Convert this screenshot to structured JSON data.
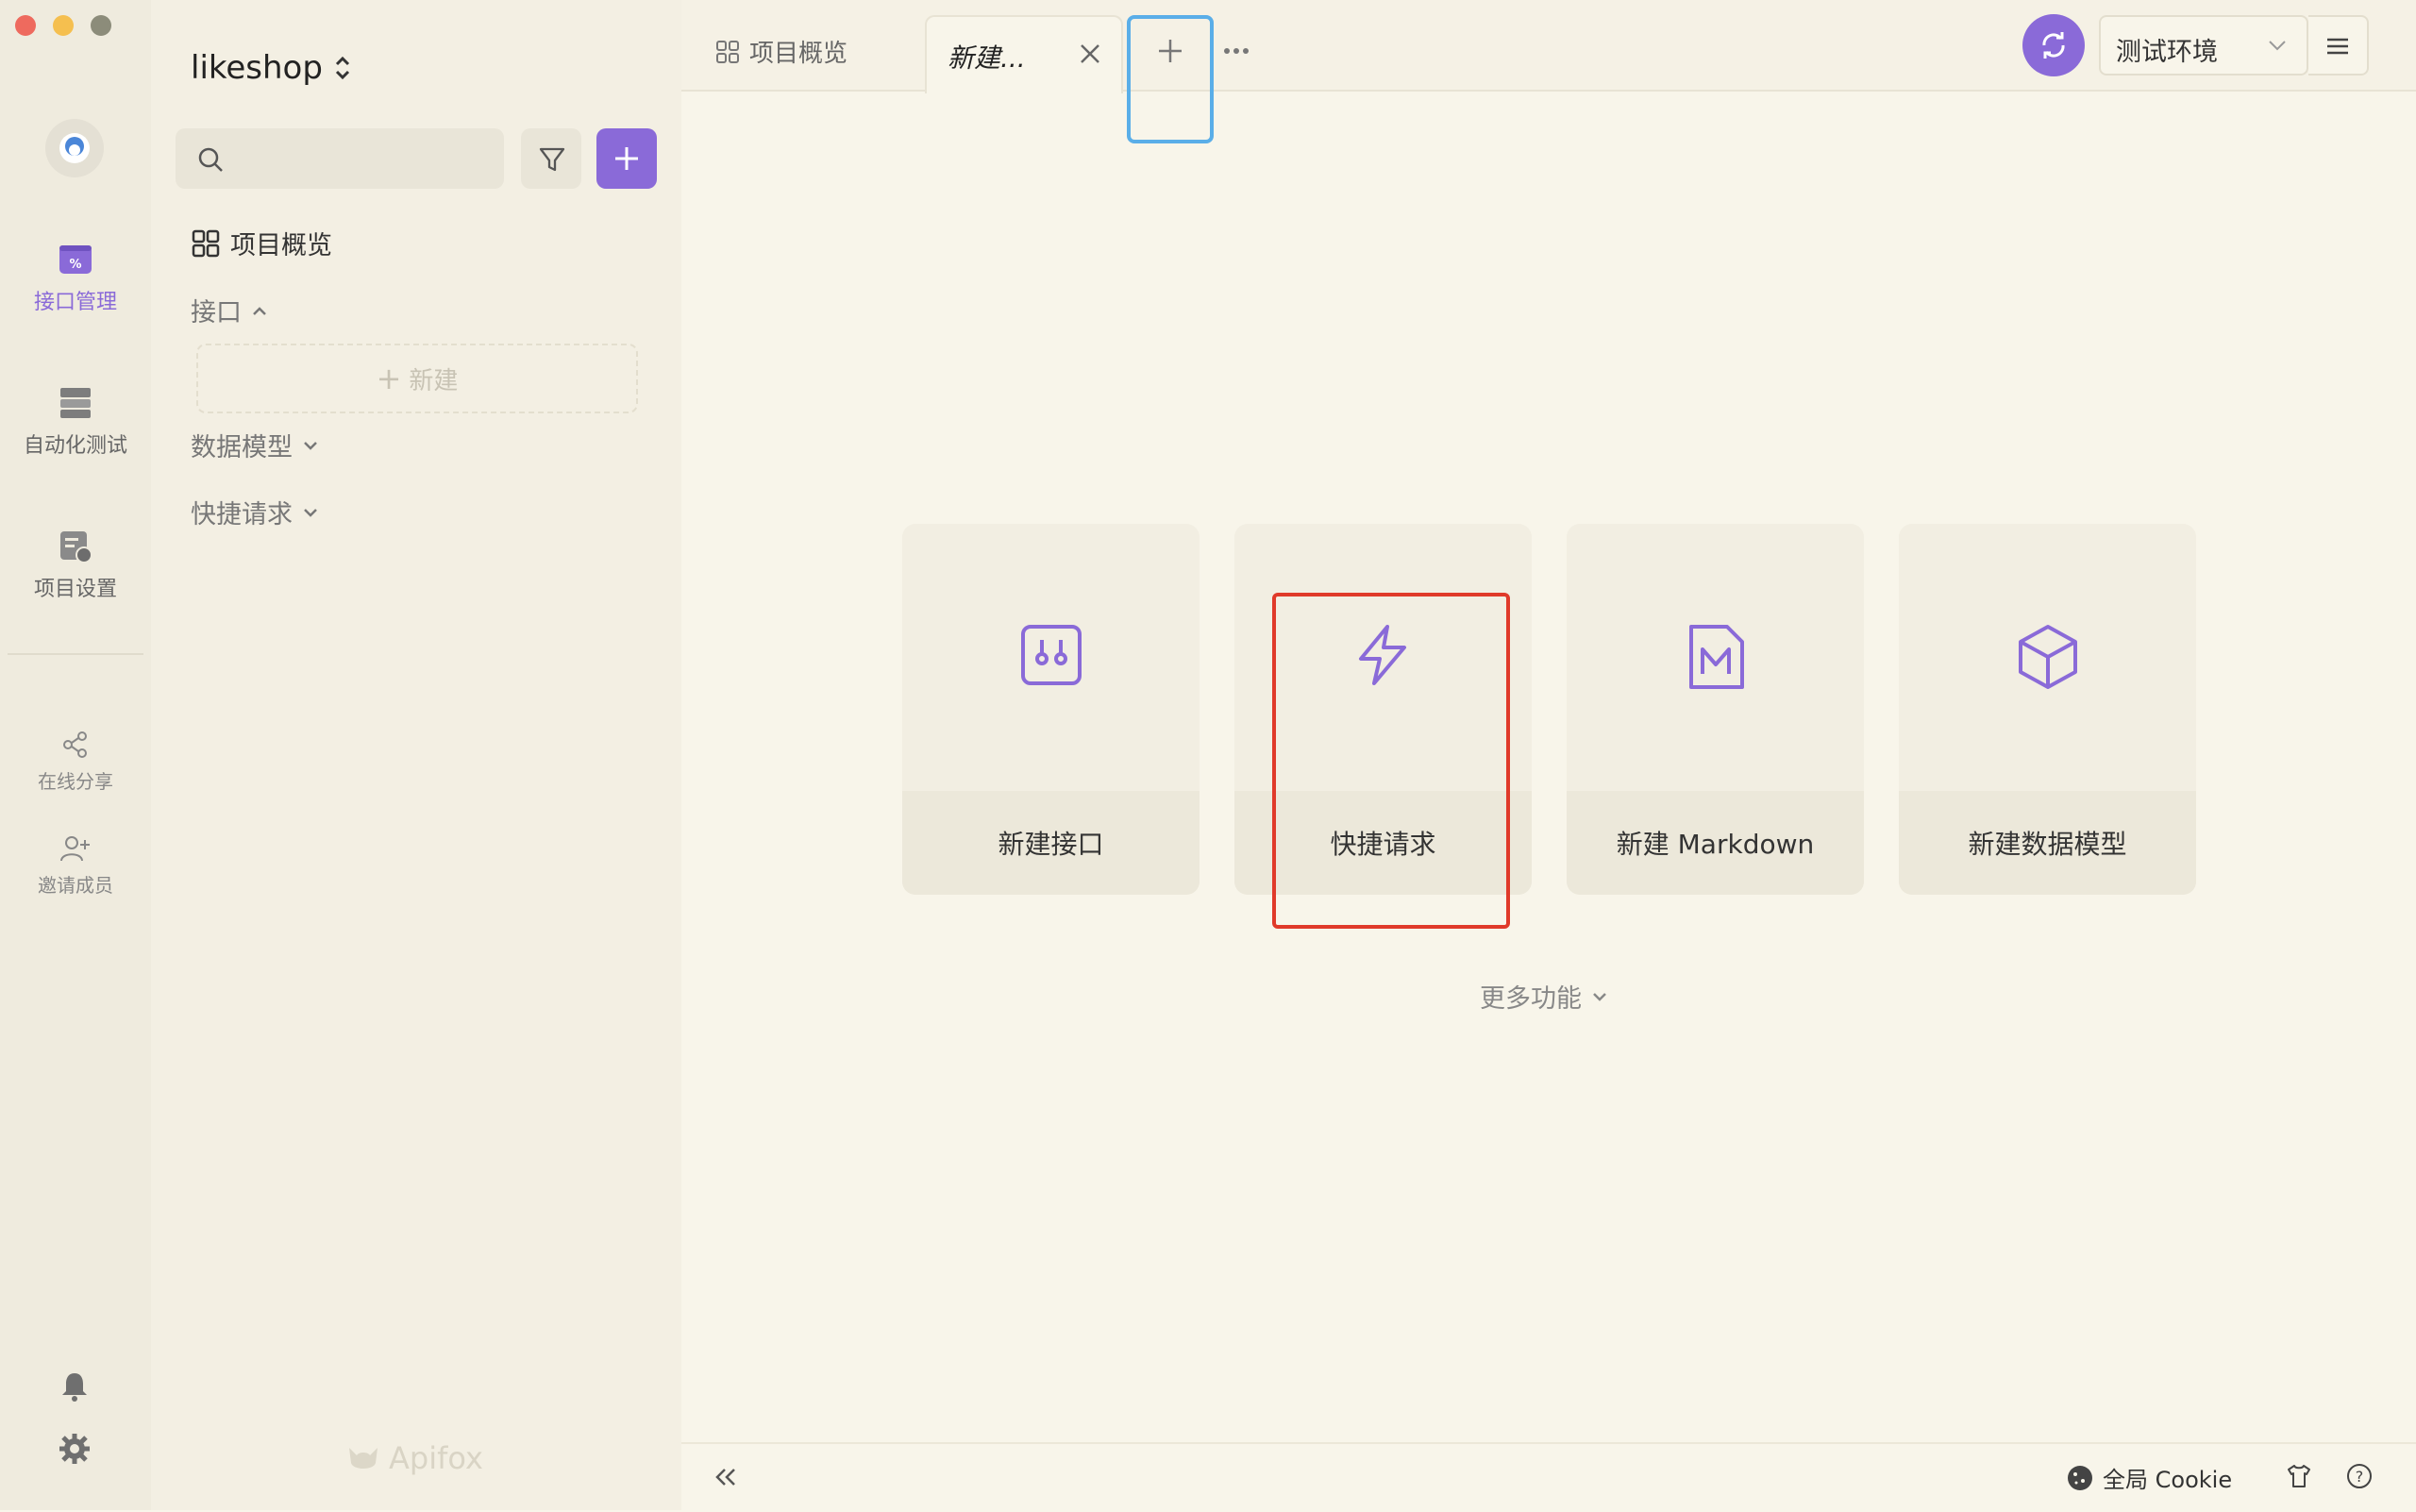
{
  "project": {
    "name": "likeshop"
  },
  "rail": {
    "items": [
      {
        "label": "接口管理",
        "icon": "api-management-icon"
      },
      {
        "label": "自动化测试",
        "icon": "automation-icon"
      },
      {
        "label": "项目设置",
        "icon": "project-settings-icon"
      }
    ],
    "share": "在线分享",
    "invite": "邀请成员"
  },
  "sidebar": {
    "search_placeholder": "",
    "overview": "项目概览",
    "api_section": "接口",
    "new_label": "新建",
    "data_model": "数据模型",
    "quick_request": "快捷请求",
    "brand": "Apifox"
  },
  "tabs": [
    {
      "label": "项目概览",
      "active": false
    },
    {
      "label": "新建...",
      "active": true
    }
  ],
  "header": {
    "env": "测试环境"
  },
  "cards": [
    {
      "label": "新建接口",
      "icon": "api-doc-icon"
    },
    {
      "label": "快捷请求",
      "icon": "lightning-icon"
    },
    {
      "label": "新建 Markdown",
      "icon": "markdown-icon"
    },
    {
      "label": "新建数据模型",
      "icon": "cube-icon"
    }
  ],
  "more_features": "更多功能",
  "status": {
    "cookie": "全局 Cookie"
  },
  "colors": {
    "accent": "#8a6ad8",
    "highlight_red": "#e03a2a",
    "highlight_blue": "#5aaee8"
  }
}
